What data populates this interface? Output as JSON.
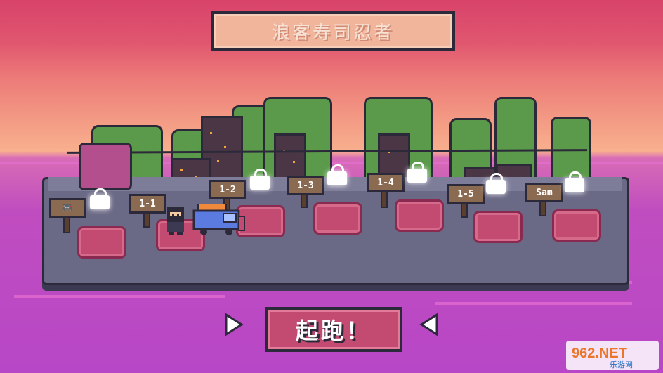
{
  "title": "浪客寿司忍者",
  "levels": [
    {
      "label": "1-1",
      "locked": false
    },
    {
      "label": "1-2",
      "locked": true
    },
    {
      "label": "1-3",
      "locked": true
    },
    {
      "label": "1-4",
      "locked": true
    },
    {
      "label": "1-5",
      "locked": true
    },
    {
      "label": "Sam",
      "locked": true
    }
  ],
  "start_button": "起跑！",
  "watermark": {
    "brand": "962.NET",
    "sub": "乐游网"
  },
  "icons": [
    "lock-icon",
    "controller-icon",
    "arrow-right-icon",
    "arrow-left-icon"
  ],
  "colors": {
    "sky_top": "#d8436a",
    "sea": "#b847c7",
    "pad": "#c34a70",
    "sign": "#8b6a52"
  }
}
